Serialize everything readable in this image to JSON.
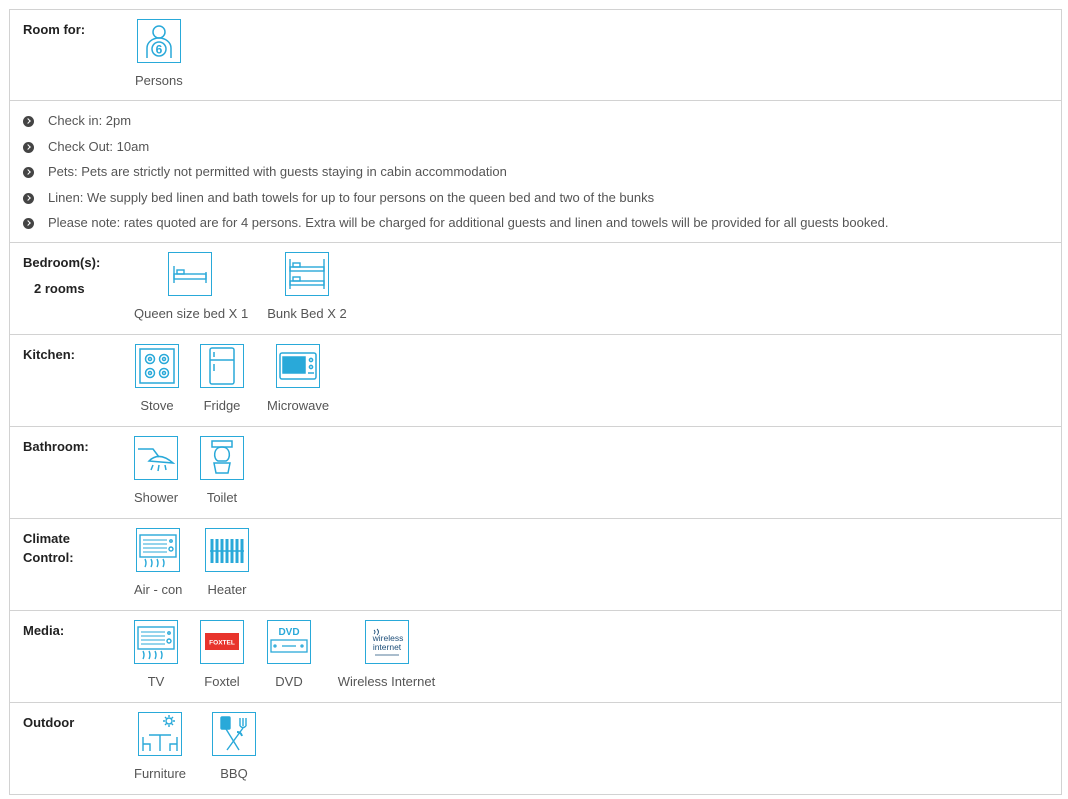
{
  "room_for": {
    "label": "Room for:",
    "count": "6",
    "caption": "Persons"
  },
  "notes": [
    "Check in: 2pm",
    "Check Out: 10am",
    "Pets: Pets are strictly not permitted with guests staying in cabin accommodation",
    "Linen: We supply bed linen and bath towels for up to four persons on the queen bed and two of the bunks",
    "Please note: rates quoted are for 4 persons. Extra will be charged for additional guests and linen and towels will be provided for all guests booked."
  ],
  "bedrooms": {
    "label": "Bedroom(s):",
    "sub": "2 rooms",
    "items": [
      "Queen size bed X 1",
      "Bunk Bed X 2"
    ]
  },
  "kitchen": {
    "label": "Kitchen:",
    "items": [
      "Stove",
      "Fridge",
      "Microwave"
    ]
  },
  "bathroom": {
    "label": "Bathroom:",
    "items": [
      "Shower",
      "Toilet"
    ]
  },
  "climate": {
    "label": "Climate Control:",
    "items": [
      "Air - con",
      "Heater"
    ]
  },
  "media": {
    "label": "Media:",
    "items": [
      "TV",
      "Foxtel",
      "DVD",
      "Wireless Internet"
    ],
    "foxtel_logo": "FOXTEL",
    "dvd_logo": "DVD",
    "wireless_logo_1": "wireless",
    "wireless_logo_2": "internet"
  },
  "outdoor": {
    "label": "Outdoor",
    "items": [
      "Furniture",
      "BBQ"
    ]
  },
  "colors": {
    "icon": "#29a9d9",
    "border": "#d2d2d2",
    "foxtel": "#e8342c"
  }
}
